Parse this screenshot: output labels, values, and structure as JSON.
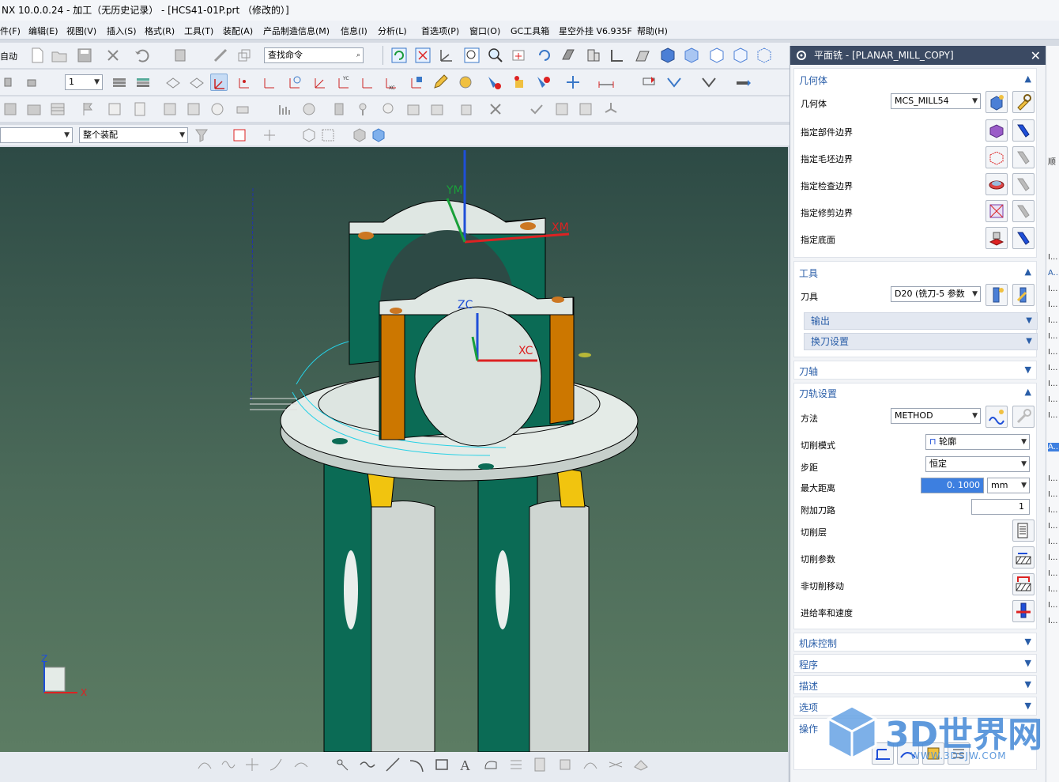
{
  "window": {
    "title": "NX 10.0.0.24 - 加工（无历史记录） - [HCS41-01P.prt （修改的）]"
  },
  "menu": [
    "件(F)",
    "编辑(E)",
    "视图(V)",
    "插入(S)",
    "格式(R)",
    "工具(T)",
    "装配(A)",
    "产品制造信息(M)",
    "信息(I)",
    "分析(L)",
    "首选项(P)",
    "窗口(O)",
    "GC工具箱",
    "星空外挂 V6.935F",
    "帮助(H)"
  ],
  "toolbar": {
    "auto_label": "自动",
    "search_placeholder": "查找命令",
    "layer_value": "1",
    "filter_value": "",
    "assembly_value": "整个装配"
  },
  "viewport": {
    "axes": {
      "ym": "YM",
      "xm": "XM",
      "zc": "ZC",
      "xc": "XC",
      "triad_z": "Z",
      "triad_x": "X"
    }
  },
  "panel": {
    "title": "平面铣 - [PLANAR_MILL_COPY]",
    "geometry": {
      "header": "几何体",
      "geom_label": "几何体",
      "geom_value": "MCS_MILL54",
      "rows": [
        "指定部件边界",
        "指定毛坯边界",
        "指定检查边界",
        "指定修剪边界",
        "指定底面"
      ]
    },
    "tool": {
      "header": "工具",
      "tool_label": "刀具",
      "tool_value": "D20 (铣刀-5 参数",
      "output": "输出",
      "change": "换刀设置"
    },
    "axis_header": "刀轴",
    "path": {
      "header": "刀轨设置",
      "method_label": "方法",
      "method_value": "METHOD",
      "cut_mode_label": "切削模式",
      "cut_mode_value": "轮廓",
      "step_label": "步距",
      "step_value": "恒定",
      "max_dist_label": "最大距离",
      "max_dist_value": "0. 1000",
      "max_dist_unit": "mm",
      "extra_label": "附加刀路",
      "extra_value": "1",
      "layers_label": "切削层",
      "params_label": "切削参数",
      "noncut_label": "非切削移动",
      "feeds_label": "进给率和速度"
    },
    "machine_header": "机床控制",
    "program_header": "程序",
    "desc_header": "描述",
    "options_header": "选项",
    "ops_header": "操作"
  },
  "rightstrip": [
    "顺",
    "I...",
    "A...",
    "I...",
    "I...",
    "I...",
    "I...",
    "I...",
    "I...",
    "I...",
    "I...",
    "I...",
    "A...",
    "I...",
    "I...",
    "I...",
    "I...",
    "I...",
    "I...",
    "I...",
    "I...",
    "I...",
    "I..."
  ],
  "watermark": {
    "brand": "3D世界网",
    "url": "WWW.3DSJW.COM"
  }
}
